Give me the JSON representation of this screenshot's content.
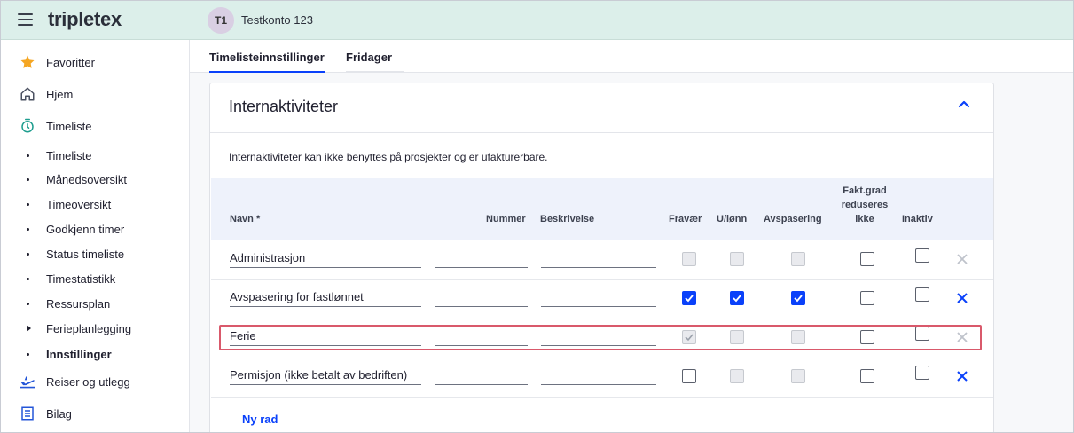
{
  "header": {
    "logo": "tripletex",
    "avatar_initials": "T1",
    "account_name": "Testkonto 123"
  },
  "sidebar": {
    "items": [
      {
        "label": "Favoritter",
        "icon": "star-icon"
      },
      {
        "label": "Hjem",
        "icon": "home-icon"
      },
      {
        "label": "Timeliste",
        "icon": "stopwatch-icon"
      },
      {
        "label": "Timeliste"
      },
      {
        "label": "Månedsoversikt"
      },
      {
        "label": "Timeoversikt"
      },
      {
        "label": "Godkjenn timer"
      },
      {
        "label": "Status timeliste"
      },
      {
        "label": "Timestatistikk"
      },
      {
        "label": "Ressursplan"
      },
      {
        "label": "Ferieplanlegging"
      },
      {
        "label": "Innstillinger"
      },
      {
        "label": "Reiser og utlegg",
        "icon": "airplane-icon"
      },
      {
        "label": "Bilag",
        "icon": "receipt-icon"
      }
    ]
  },
  "tabs": [
    {
      "label": "Timelisteinnstillinger",
      "active": true
    },
    {
      "label": "Fridager",
      "active": false
    }
  ],
  "card": {
    "title": "Internaktiviteter",
    "description": "Internaktiviteter kan ikke benyttes på prosjekter og er ufakturerbare.",
    "columns": {
      "navn": "Navn *",
      "nummer": "Nummer",
      "beskrivelse": "Beskrivelse",
      "fravaer": "Fravær",
      "ulonn": "U/lønn",
      "avspasering": "Avspasering",
      "fakt_line1": "Fakt.grad",
      "fakt_line2": "reduseres",
      "fakt_line3": "ikke",
      "inaktiv": "Inaktiv"
    },
    "rows": [
      {
        "navn": "Administrasjon",
        "nummer": "",
        "beskrivelse": "",
        "fravaer": false,
        "ulonn": false,
        "avspasering": false,
        "fakt": false,
        "inaktiv": false
      },
      {
        "navn": "Avspasering for fastlønnet",
        "nummer": "",
        "beskrivelse": "",
        "fravaer": true,
        "ulonn": true,
        "avspasering": true,
        "fakt": false,
        "inaktiv": false
      },
      {
        "navn": "Ferie",
        "nummer": "",
        "beskrivelse": "",
        "fravaer": true,
        "ulonn": false,
        "avspasering": false,
        "fakt": false,
        "inaktiv": false
      },
      {
        "navn": "Permisjon (ikke betalt av bedriften)",
        "nummer": "",
        "beskrivelse": "",
        "fravaer": false,
        "ulonn": false,
        "avspasering": false,
        "fakt": false,
        "inaktiv": false
      }
    ],
    "new_row_label": "Ny rad"
  },
  "colors": {
    "accent": "#0a41fa",
    "topbar_bg": "#dcefea",
    "highlight": "#d9596b"
  }
}
